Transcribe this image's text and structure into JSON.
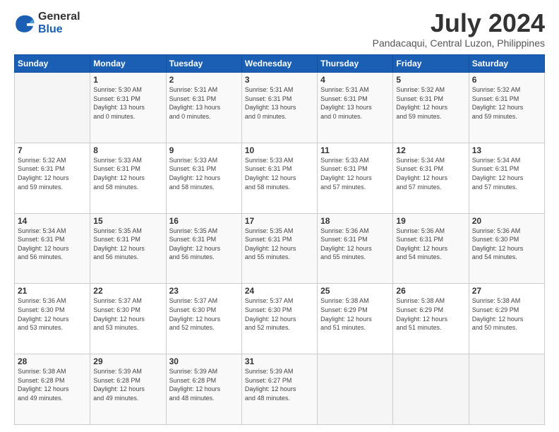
{
  "logo": {
    "general": "General",
    "blue": "Blue"
  },
  "title": "July 2024",
  "subtitle": "Pandacaqui, Central Luzon, Philippines",
  "header_days": [
    "Sunday",
    "Monday",
    "Tuesday",
    "Wednesday",
    "Thursday",
    "Friday",
    "Saturday"
  ],
  "weeks": [
    [
      {
        "day": "",
        "info": ""
      },
      {
        "day": "1",
        "info": "Sunrise: 5:30 AM\nSunset: 6:31 PM\nDaylight: 13 hours\nand 0 minutes."
      },
      {
        "day": "2",
        "info": "Sunrise: 5:31 AM\nSunset: 6:31 PM\nDaylight: 13 hours\nand 0 minutes."
      },
      {
        "day": "3",
        "info": "Sunrise: 5:31 AM\nSunset: 6:31 PM\nDaylight: 13 hours\nand 0 minutes."
      },
      {
        "day": "4",
        "info": "Sunrise: 5:31 AM\nSunset: 6:31 PM\nDaylight: 13 hours\nand 0 minutes."
      },
      {
        "day": "5",
        "info": "Sunrise: 5:32 AM\nSunset: 6:31 PM\nDaylight: 12 hours\nand 59 minutes."
      },
      {
        "day": "6",
        "info": "Sunrise: 5:32 AM\nSunset: 6:31 PM\nDaylight: 12 hours\nand 59 minutes."
      }
    ],
    [
      {
        "day": "7",
        "info": "Sunrise: 5:32 AM\nSunset: 6:31 PM\nDaylight: 12 hours\nand 59 minutes."
      },
      {
        "day": "8",
        "info": "Sunrise: 5:33 AM\nSunset: 6:31 PM\nDaylight: 12 hours\nand 58 minutes."
      },
      {
        "day": "9",
        "info": "Sunrise: 5:33 AM\nSunset: 6:31 PM\nDaylight: 12 hours\nand 58 minutes."
      },
      {
        "day": "10",
        "info": "Sunrise: 5:33 AM\nSunset: 6:31 PM\nDaylight: 12 hours\nand 58 minutes."
      },
      {
        "day": "11",
        "info": "Sunrise: 5:33 AM\nSunset: 6:31 PM\nDaylight: 12 hours\nand 57 minutes."
      },
      {
        "day": "12",
        "info": "Sunrise: 5:34 AM\nSunset: 6:31 PM\nDaylight: 12 hours\nand 57 minutes."
      },
      {
        "day": "13",
        "info": "Sunrise: 5:34 AM\nSunset: 6:31 PM\nDaylight: 12 hours\nand 57 minutes."
      }
    ],
    [
      {
        "day": "14",
        "info": "Sunrise: 5:34 AM\nSunset: 6:31 PM\nDaylight: 12 hours\nand 56 minutes."
      },
      {
        "day": "15",
        "info": "Sunrise: 5:35 AM\nSunset: 6:31 PM\nDaylight: 12 hours\nand 56 minutes."
      },
      {
        "day": "16",
        "info": "Sunrise: 5:35 AM\nSunset: 6:31 PM\nDaylight: 12 hours\nand 56 minutes."
      },
      {
        "day": "17",
        "info": "Sunrise: 5:35 AM\nSunset: 6:31 PM\nDaylight: 12 hours\nand 55 minutes."
      },
      {
        "day": "18",
        "info": "Sunrise: 5:36 AM\nSunset: 6:31 PM\nDaylight: 12 hours\nand 55 minutes."
      },
      {
        "day": "19",
        "info": "Sunrise: 5:36 AM\nSunset: 6:31 PM\nDaylight: 12 hours\nand 54 minutes."
      },
      {
        "day": "20",
        "info": "Sunrise: 5:36 AM\nSunset: 6:30 PM\nDaylight: 12 hours\nand 54 minutes."
      }
    ],
    [
      {
        "day": "21",
        "info": "Sunrise: 5:36 AM\nSunset: 6:30 PM\nDaylight: 12 hours\nand 53 minutes."
      },
      {
        "day": "22",
        "info": "Sunrise: 5:37 AM\nSunset: 6:30 PM\nDaylight: 12 hours\nand 53 minutes."
      },
      {
        "day": "23",
        "info": "Sunrise: 5:37 AM\nSunset: 6:30 PM\nDaylight: 12 hours\nand 52 minutes."
      },
      {
        "day": "24",
        "info": "Sunrise: 5:37 AM\nSunset: 6:30 PM\nDaylight: 12 hours\nand 52 minutes."
      },
      {
        "day": "25",
        "info": "Sunrise: 5:38 AM\nSunset: 6:29 PM\nDaylight: 12 hours\nand 51 minutes."
      },
      {
        "day": "26",
        "info": "Sunrise: 5:38 AM\nSunset: 6:29 PM\nDaylight: 12 hours\nand 51 minutes."
      },
      {
        "day": "27",
        "info": "Sunrise: 5:38 AM\nSunset: 6:29 PM\nDaylight: 12 hours\nand 50 minutes."
      }
    ],
    [
      {
        "day": "28",
        "info": "Sunrise: 5:38 AM\nSunset: 6:28 PM\nDaylight: 12 hours\nand 49 minutes."
      },
      {
        "day": "29",
        "info": "Sunrise: 5:39 AM\nSunset: 6:28 PM\nDaylight: 12 hours\nand 49 minutes."
      },
      {
        "day": "30",
        "info": "Sunrise: 5:39 AM\nSunset: 6:28 PM\nDaylight: 12 hours\nand 48 minutes."
      },
      {
        "day": "31",
        "info": "Sunrise: 5:39 AM\nSunset: 6:27 PM\nDaylight: 12 hours\nand 48 minutes."
      },
      {
        "day": "",
        "info": ""
      },
      {
        "day": "",
        "info": ""
      },
      {
        "day": "",
        "info": ""
      }
    ]
  ]
}
